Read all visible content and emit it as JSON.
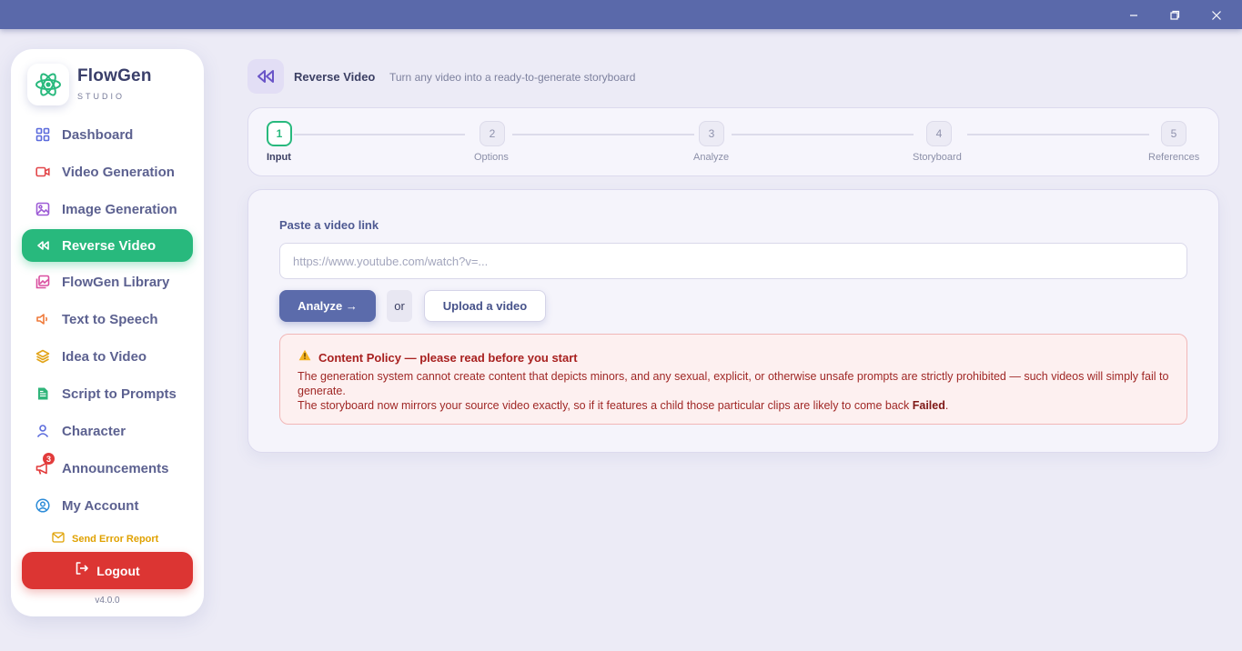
{
  "window": {
    "controls": {
      "minimize": "minimize-icon",
      "maximize": "maximize-icon",
      "close": "close-icon"
    }
  },
  "brand": {
    "name": "FlowGen",
    "subtitle": "STUDIO",
    "logo_icon": "atom-icon",
    "accent_color": "#28b97d"
  },
  "sidebar": {
    "items": [
      {
        "label": "Dashboard",
        "icon": "grid-icon"
      },
      {
        "label": "Video Generation",
        "icon": "video-camera-icon"
      },
      {
        "label": "Image Generation",
        "icon": "image-icon"
      },
      {
        "label": "Reverse Video",
        "icon": "rewind-icon",
        "active": true
      },
      {
        "label": "FlowGen Library",
        "icon": "library-icon"
      },
      {
        "label": "Text to Speech",
        "icon": "speaker-icon"
      },
      {
        "label": "Idea to Video",
        "icon": "layers-icon"
      },
      {
        "label": "Script to Prompts",
        "icon": "document-icon"
      },
      {
        "label": "Character",
        "icon": "person-icon"
      },
      {
        "label": "Announcements",
        "icon": "megaphone-icon",
        "badge": "3"
      },
      {
        "label": "My Account",
        "icon": "user-circle-icon"
      }
    ],
    "error_report": "Send Error Report",
    "logout": "Logout",
    "version": "v4.0.0"
  },
  "header": {
    "title": "Reverse Video",
    "subtitle": "Turn any video into a ready-to-generate storyboard"
  },
  "stepper": {
    "steps": [
      {
        "number": "1",
        "label": "Input",
        "active": true
      },
      {
        "number": "2",
        "label": "Options"
      },
      {
        "number": "3",
        "label": "Analyze"
      },
      {
        "number": "4",
        "label": "Storyboard"
      },
      {
        "number": "5",
        "label": "References"
      }
    ]
  },
  "form": {
    "label": "Paste a video link",
    "placeholder": "https://www.youtube.com/watch?v=...",
    "value": "",
    "analyze": "Analyze →",
    "or": "or",
    "upload": "Upload a video"
  },
  "policy": {
    "title": "Content Policy — please read before you start",
    "line1": "The generation system cannot create content that depicts minors, and any sexual, explicit, or otherwise unsafe prompts are strictly prohibited — such videos will simply fail to generate.",
    "line2_prefix": "The storyboard now mirrors your source video exactly, so if it features a child those particular clips are likely to come back ",
    "line2_bold": "Failed",
    "line2_suffix": "."
  }
}
